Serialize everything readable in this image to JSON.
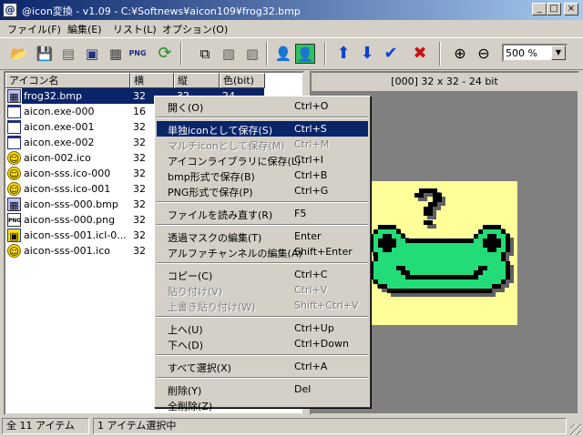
{
  "window": {
    "title": "@icon変換 - v1.09 - C:¥Softnews¥aicon109¥frog32.bmp",
    "app_icon": "@",
    "minimize": "_",
    "maximize": "□",
    "close": "×"
  },
  "menu": [
    "ファイル(F)",
    "編集(E)",
    "リスト(L)",
    "オプション(O)"
  ],
  "toolbar": {
    "icons": [
      "open-folder-icon",
      "save-icon",
      "save-multi-icon",
      "save-library-icon",
      "save-bmp-icon",
      "save-png-icon",
      "reload-icon",
      "copy-icon",
      "paste-icon",
      "overwrite-paste-icon",
      "mask-icon",
      "alpha-icon",
      "up-arrow-icon",
      "down-arrow-icon",
      "select-all-check-icon",
      "delete-x-icon",
      "zoom-in-icon",
      "zoom-out-icon"
    ],
    "png_label": "PNG",
    "zoom_value": "500 %",
    "zoom_arrow": "▼"
  },
  "list": {
    "headers": [
      "アイコン名",
      "横",
      "縦",
      "色(bit)"
    ],
    "rows": [
      {
        "icon": "bmp",
        "name": "frog32.bmp",
        "w": "32",
        "h": "32",
        "c": "24",
        "selected": true
      },
      {
        "icon": "exe",
        "name": "aicon.exe-000",
        "w": "16",
        "h": "",
        "c": ""
      },
      {
        "icon": "exe",
        "name": "aicon.exe-001",
        "w": "32",
        "h": "",
        "c": ""
      },
      {
        "icon": "exe",
        "name": "aicon.exe-002",
        "w": "32",
        "h": "",
        "c": ""
      },
      {
        "icon": "smile",
        "name": "aicon-002.ico",
        "w": "32",
        "h": "",
        "c": ""
      },
      {
        "icon": "smile",
        "name": "aicon-sss.ico-000",
        "w": "32",
        "h": "",
        "c": ""
      },
      {
        "icon": "smile",
        "name": "aicon-sss.ico-001",
        "w": "32",
        "h": "",
        "c": ""
      },
      {
        "icon": "bmp",
        "name": "aicon-sss-000.bmp",
        "w": "32",
        "h": "",
        "c": ""
      },
      {
        "icon": "png",
        "name": "aicon-sss-000.png",
        "w": "32",
        "h": "",
        "c": ""
      },
      {
        "icon": "icl",
        "name": "aicon-sss-001.icl-0...",
        "w": "32",
        "h": "",
        "c": ""
      },
      {
        "icon": "smile",
        "name": "aicon-sss-001.ico",
        "w": "32",
        "h": "",
        "c": ""
      }
    ]
  },
  "preview": {
    "header": "[000] 32 x 32 - 24 bit"
  },
  "context_menu": {
    "items": [
      {
        "label": "開く(O)",
        "key": "Ctrl+O"
      },
      {
        "sep": true
      },
      {
        "label": "単独iconとして保存(S)",
        "key": "Ctrl+S",
        "highlighted": true
      },
      {
        "label": "マルチiconとして保存(M)",
        "key": "Ctrl+M",
        "disabled": true
      },
      {
        "label": "アイコンライブラリに保存(L)",
        "key": "Ctrl+I"
      },
      {
        "label": "bmp形式で保存(B)",
        "key": "Ctrl+B"
      },
      {
        "label": "PNG形式で保存(P)",
        "key": "Ctrl+G"
      },
      {
        "sep": true
      },
      {
        "label": "ファイルを読み直す(R)",
        "key": "F5"
      },
      {
        "sep": true
      },
      {
        "label": "透過マスクの編集(T)",
        "key": "Enter"
      },
      {
        "label": "アルファチャンネルの編集(A)",
        "key": "Shift+Enter"
      },
      {
        "sep": true
      },
      {
        "label": "コピー(C)",
        "key": "Ctrl+C"
      },
      {
        "label": "貼り付け(V)",
        "key": "Ctrl+V",
        "disabled": true
      },
      {
        "label": "上書き貼り付け(W)",
        "key": "Shift+Ctrl+V",
        "disabled": true
      },
      {
        "sep": true
      },
      {
        "label": "上へ(U)",
        "key": "Ctrl+Up"
      },
      {
        "label": "下へ(D)",
        "key": "Ctrl+Down"
      },
      {
        "sep": true
      },
      {
        "label": "すべて選択(X)",
        "key": "Ctrl+A"
      },
      {
        "sep": true
      },
      {
        "label": "削除(Y)",
        "key": "Del"
      },
      {
        "label": "全削除(Z)",
        "key": ""
      }
    ]
  },
  "status": {
    "total": "全 11 アイテム",
    "selected": "1 アイテム選択中"
  },
  "colors": {
    "title_start": "#0a246a",
    "title_end": "#a6caf0",
    "selection": "#0a246a",
    "frog_green": "#22dd77",
    "frog_bg": "#ffff99"
  }
}
